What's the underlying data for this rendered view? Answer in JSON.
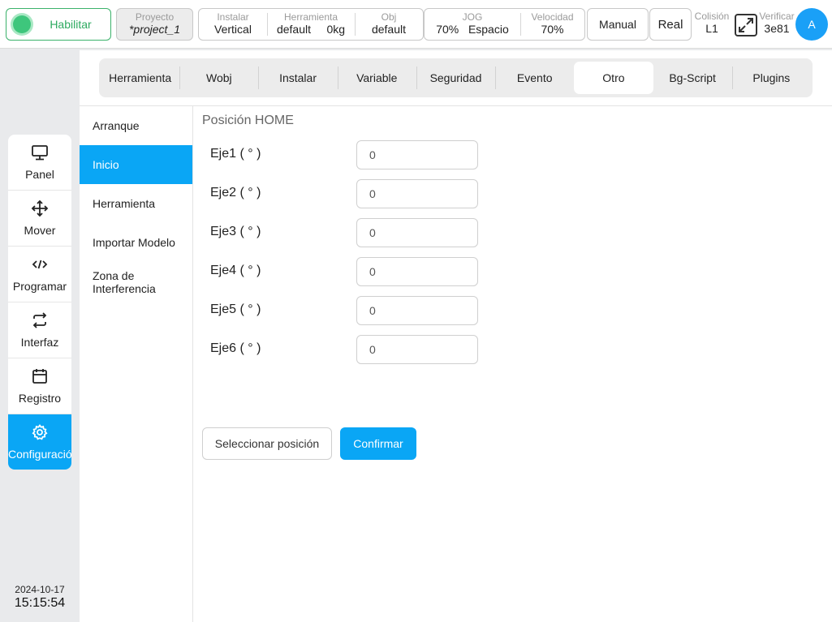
{
  "topbar": {
    "enable_label": "Habilitar",
    "project": {
      "label": "Proyecto",
      "value": "*project_1"
    },
    "install": {
      "label": "Instalar",
      "value": "Vertical"
    },
    "tool": {
      "label": "Herramienta",
      "value": "default",
      "weight": "0kg"
    },
    "obj": {
      "label": "Obj",
      "value": "default"
    },
    "jog": {
      "label": "JOG",
      "percent": "70%",
      "mode": "Espacio"
    },
    "speed": {
      "label": "Velocidad",
      "value": "70%"
    },
    "manual_label": "Manual",
    "real_label": "Real",
    "collision": {
      "label": "Colisión",
      "value": "L1"
    },
    "verify": {
      "label": "Verificar",
      "value": "3e81"
    },
    "avatar_letter": "A"
  },
  "nav": {
    "items": [
      {
        "label": "Panel",
        "icon": "monitor-icon"
      },
      {
        "label": "Mover",
        "icon": "move-icon"
      },
      {
        "label": "Programar",
        "icon": "code-icon"
      },
      {
        "label": "Interfaz",
        "icon": "swap-icon"
      },
      {
        "label": "Registro",
        "icon": "calendar-icon"
      },
      {
        "label": "Configuración",
        "icon": "gear-icon"
      }
    ],
    "active": "Configuración"
  },
  "clock": {
    "date": "2024-10-17",
    "time": "15:15:54"
  },
  "tabs": {
    "items": [
      "Herramienta",
      "Wobj",
      "Instalar",
      "Variable",
      "Seguridad",
      "Evento",
      "Otro",
      "Bg-Script",
      "Plugins"
    ],
    "active": "Otro"
  },
  "subnav": {
    "items": [
      "Arranque",
      "Inicio",
      "Herramienta",
      "Importar Modelo",
      "Zona de Interferencia"
    ],
    "active": "Inicio"
  },
  "home": {
    "title": "Posición HOME",
    "axes": [
      {
        "label": "Eje1 ( ° )",
        "value": "0"
      },
      {
        "label": "Eje2 ( ° )",
        "value": "0"
      },
      {
        "label": "Eje3 ( ° )",
        "value": "0"
      },
      {
        "label": "Eje4 ( ° )",
        "value": "0"
      },
      {
        "label": "Eje5 ( ° )",
        "value": "0"
      },
      {
        "label": "Eje6 ( ° )",
        "value": "0"
      }
    ],
    "select_label": "Seleccionar posición",
    "confirm_label": "Confirmar"
  },
  "colors": {
    "accent": "#0aa6f5",
    "enable_green": "#3ec67c"
  }
}
